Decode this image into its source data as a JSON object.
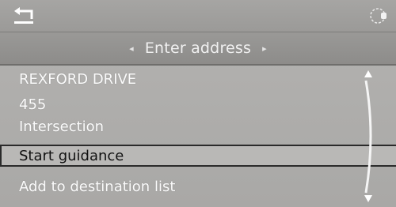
{
  "header": {
    "title": "Enter address",
    "prev_arrow": "◂",
    "next_arrow": "▸"
  },
  "icons": {
    "back": "back-arrow-icon",
    "controller": "idrive-controller-icon",
    "scroll_up": "scroll-up-arrow-icon",
    "scroll_down": "scroll-down-arrow-icon"
  },
  "list": {
    "items": [
      {
        "label": "REXFORD DRIVE"
      },
      {
        "label": "455"
      },
      {
        "label": "Intersection"
      },
      {
        "label": "Start guidance"
      },
      {
        "label": "Add to destination list"
      }
    ],
    "selected_index": 3
  },
  "colors": {
    "background": "#b4b3b1",
    "header_bg": "#9a9997",
    "text": "#fbfbfb",
    "selected_text": "#111111",
    "selected_border": "#2a2a2a"
  }
}
